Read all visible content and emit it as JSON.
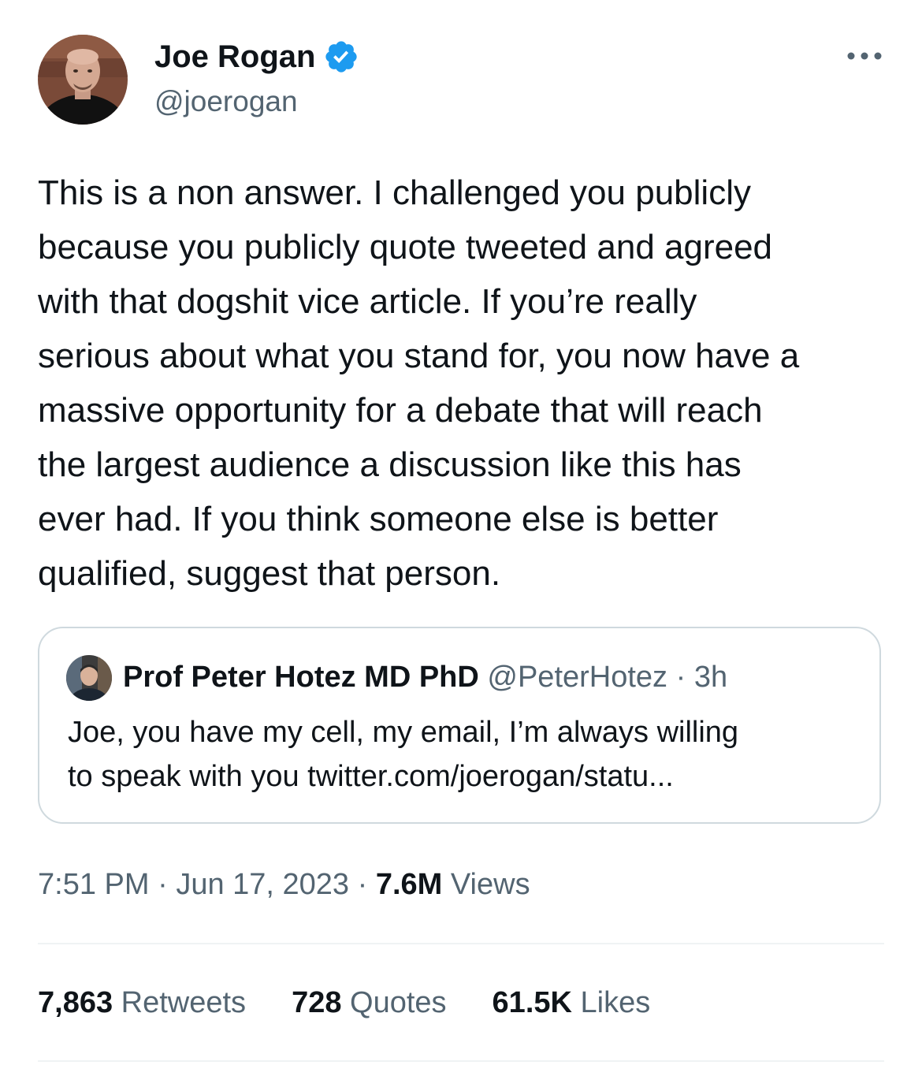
{
  "author": {
    "name": "Joe Rogan",
    "handle": "@joerogan",
    "verified_icon": "verified-badge-icon",
    "verified_color": "#1d9bf0"
  },
  "more_icon": "more-horizontal-icon",
  "tweet": {
    "lines": [
      "This is a non answer.  I challenged you publicly",
      "because you publicly quote tweeted and agreed",
      "with that dogshit vice article.  If you’re really",
      "serious about what you stand for, you now have a",
      "massive opportunity for a debate that will reach",
      "the largest audience a discussion like this has",
      "ever had.  If you think someone else is better",
      "qualified, suggest that person."
    ]
  },
  "quote": {
    "name": "Prof Peter Hotez MD PhD",
    "handle": "@PeterHotez",
    "separator": " · ",
    "time": "3h",
    "lines": [
      "Joe, you have my cell, my email, I’m always willing",
      "to speak with you twitter.com/joerogan/statu..."
    ]
  },
  "meta": {
    "time": "7:51 PM",
    "sep1": " · ",
    "date": "Jun 17, 2023",
    "sep2": " · ",
    "views_count": "7.6M",
    "views_label": " Views"
  },
  "stats": {
    "retweets_count": "7,863",
    "retweets_label": " Retweets",
    "quotes_count": "728",
    "quotes_label": " Quotes",
    "likes_count": "61.5K",
    "likes_label": " Likes"
  }
}
